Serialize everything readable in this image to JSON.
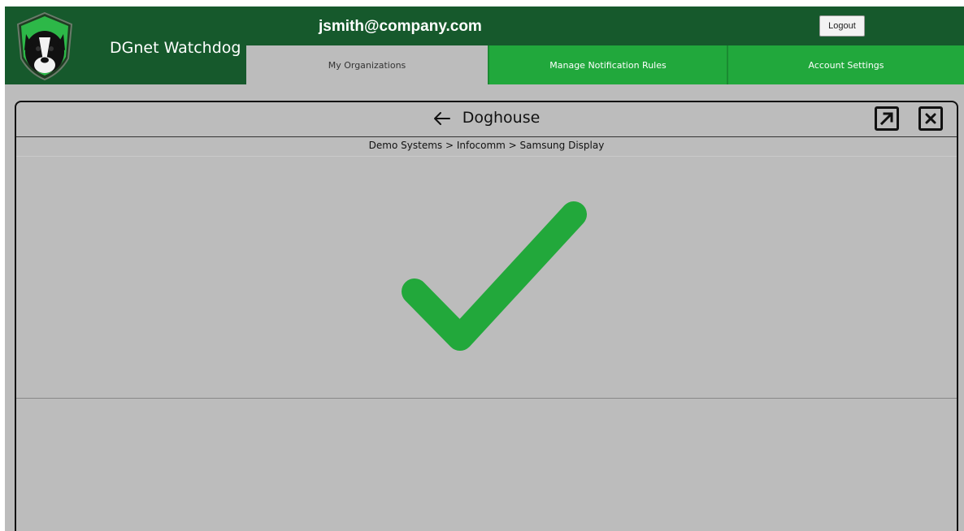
{
  "app": {
    "brand_name": "DGnet Watchdog",
    "user_email": "jsmith@company.com",
    "logout_label": "Logout"
  },
  "tabs": [
    {
      "label": "My Organizations",
      "active": true
    },
    {
      "label": "Manage Notification Rules",
      "active": false
    },
    {
      "label": "Account Settings",
      "active": false
    }
  ],
  "panel": {
    "title": "Doghouse",
    "breadcrumb": "Demo Systems > Infocomm > Samsung Display",
    "status": "ok"
  },
  "icons": {
    "logo": "dog-shield-logo-icon",
    "back": "arrow-left-icon",
    "expand": "expand-arrow-icon",
    "close": "close-icon",
    "status": "checkmark-icon"
  },
  "colors": {
    "header_bg": "#16592c",
    "tab_green": "#21a83c",
    "checkmark": "#22a83b",
    "page_bg": "#bcbcbc"
  }
}
